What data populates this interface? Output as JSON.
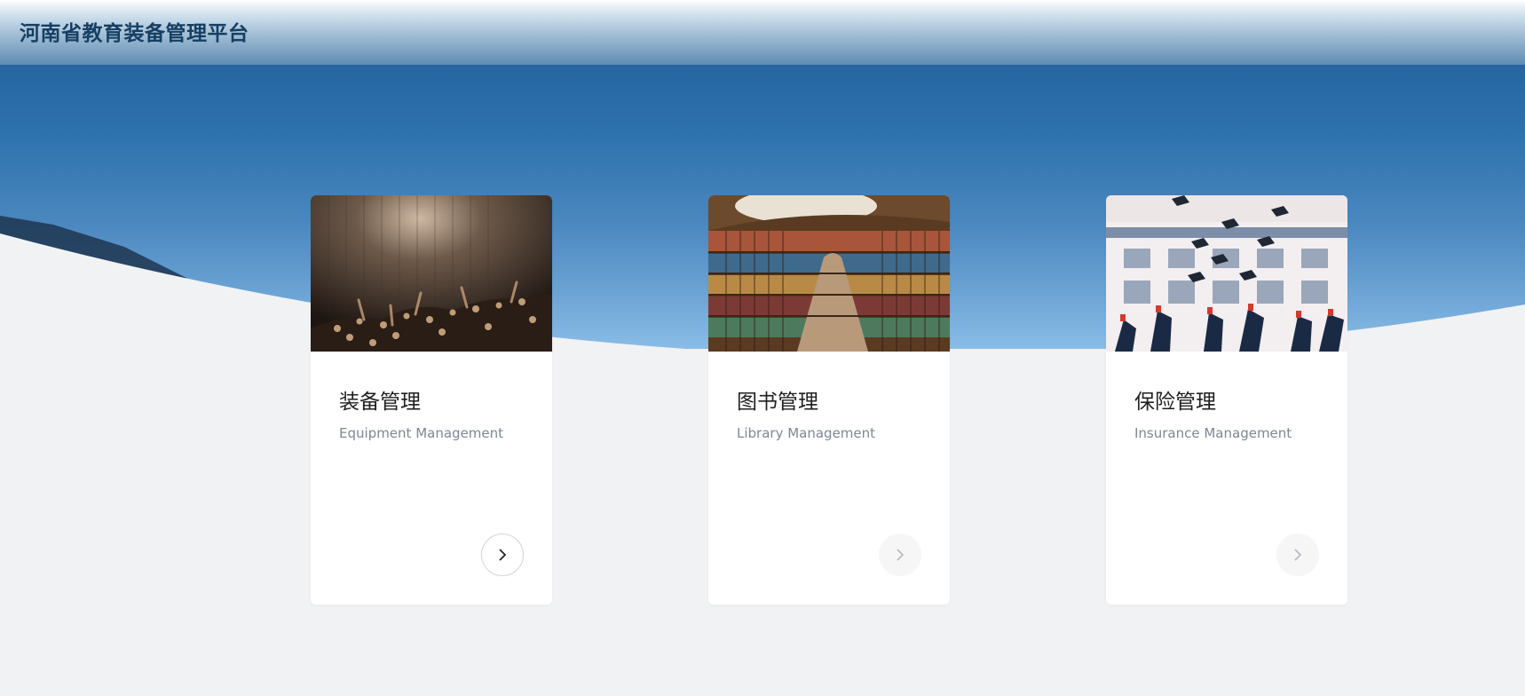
{
  "header": {
    "title": "河南省教育装备管理平台"
  },
  "theme": {
    "header_text": "#163f63",
    "sky": "#2e72ad",
    "page_bg": "#f1f2f4",
    "card_bg": "#ffffff",
    "subtitle": "#7d8793"
  },
  "cards": [
    {
      "title": "装备管理",
      "subtitle": "Equipment Management",
      "image": "concert-crowd-photo",
      "arrow_icon": "chevron-right-icon",
      "arrow_state": "active"
    },
    {
      "title": "图书管理",
      "subtitle": "Library Management",
      "image": "library-bookshelves-photo",
      "arrow_icon": "chevron-right-icon",
      "arrow_state": "inactive"
    },
    {
      "title": "保险管理",
      "subtitle": "Insurance Management",
      "image": "graduation-caps-photo",
      "arrow_icon": "chevron-right-icon",
      "arrow_state": "inactive"
    }
  ]
}
